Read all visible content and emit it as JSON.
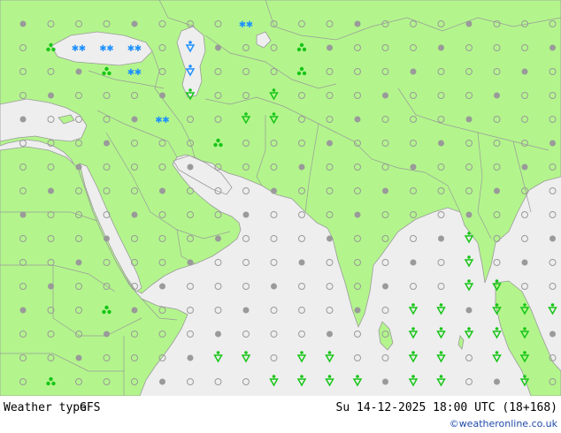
{
  "map": {
    "land_color": "#b3f58c",
    "sea_color": "#eeeeee",
    "border_color": "#9a9a9a",
    "marker_color": "#9a9a9a",
    "rain_color": "#17c517",
    "snow_color": "#1e90ff"
  },
  "footer": {
    "label": "Weather type",
    "model": "GFS",
    "datetime": "Su 14-12-2025 18:00 UTC (18+168)",
    "credit": "©weatheronline.co.uk"
  }
}
